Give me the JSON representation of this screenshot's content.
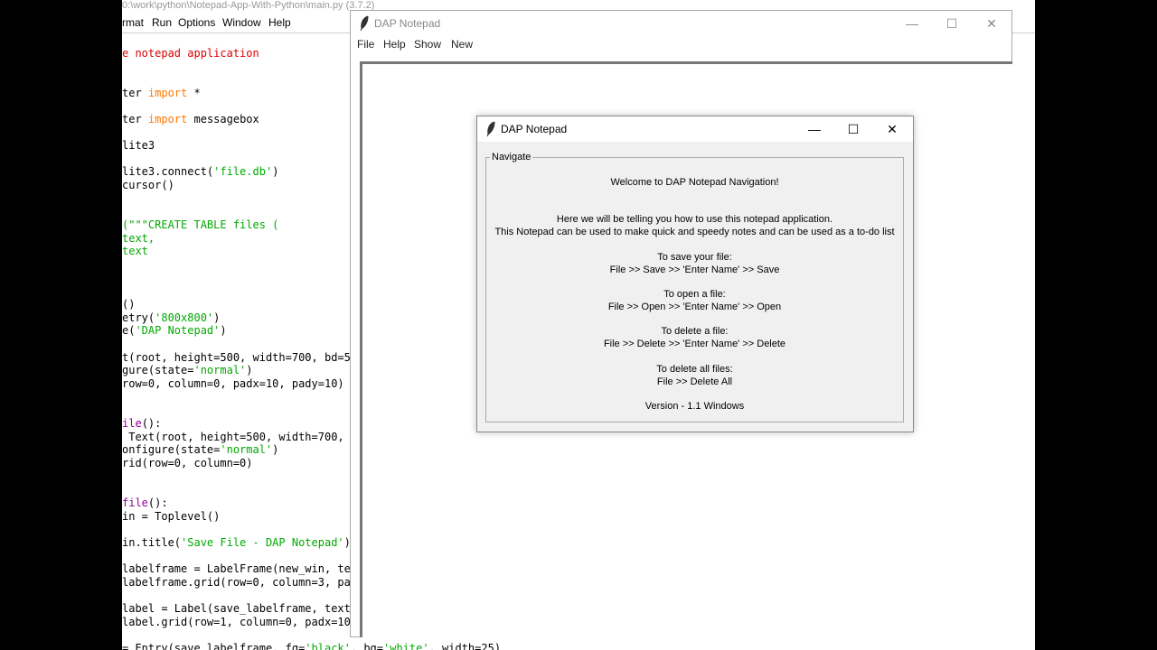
{
  "editor": {
    "title": "0:\\work\\python\\Notepad-App-With-Python\\main.py (3.7.2)",
    "menu": [
      "rmat",
      "Run",
      "Options",
      "Window",
      "Help"
    ],
    "code": [
      [
        {
          "t": "e notepad application",
          "c": "red"
        }
      ],
      [
        {
          "t": "ter ",
          "c": ""
        },
        {
          "t": "import",
          "c": "orange"
        },
        {
          "t": " *",
          "c": ""
        }
      ],
      [
        {
          "t": "ter ",
          "c": ""
        },
        {
          "t": "import",
          "c": "orange"
        },
        {
          "t": " messagebox",
          "c": ""
        }
      ],
      [
        {
          "t": "lite3",
          "c": ""
        }
      ],
      [
        {
          "t": "lite3.connect(",
          "c": ""
        },
        {
          "t": "'file.db'",
          "c": "green"
        },
        {
          "t": ")",
          "c": ""
        }
      ],
      [
        {
          "t": "cursor()",
          "c": ""
        }
      ],
      [
        {
          "t": "(\"\"\"CREATE TABLE files (",
          "c": "green"
        }
      ],
      [
        {
          "t": "text,",
          "c": "green"
        }
      ],
      [
        {
          "t": "text",
          "c": "green"
        }
      ],
      [
        {
          "t": "()",
          "c": ""
        }
      ],
      [
        {
          "t": "etry(",
          "c": ""
        },
        {
          "t": "'800x800'",
          "c": "green"
        },
        {
          "t": ")",
          "c": ""
        }
      ],
      [
        {
          "t": "e(",
          "c": ""
        },
        {
          "t": "'DAP Notepad'",
          "c": "green"
        },
        {
          "t": ")",
          "c": ""
        }
      ],
      [
        {
          "t": "t(root, height=500, width=700, bd=5",
          "c": ""
        }
      ],
      [
        {
          "t": "gure(state=",
          "c": ""
        },
        {
          "t": "'normal'",
          "c": "green"
        },
        {
          "t": ")",
          "c": ""
        }
      ],
      [
        {
          "t": "row=0, column=0, padx=10, pady=10)",
          "c": ""
        }
      ],
      [
        {
          "t": "ile",
          "c": "purple"
        },
        {
          "t": "():",
          "c": ""
        }
      ],
      [
        {
          "t": " Text(root, height=500, width=700,",
          "c": ""
        }
      ],
      [
        {
          "t": "onfigure(state=",
          "c": ""
        },
        {
          "t": "'normal'",
          "c": "green"
        },
        {
          "t": ")",
          "c": ""
        }
      ],
      [
        {
          "t": "rid(row=0, column=0)",
          "c": ""
        }
      ],
      [
        {
          "t": "file",
          "c": "purple"
        },
        {
          "t": "():",
          "c": ""
        }
      ],
      [
        {
          "t": "in = Toplevel()",
          "c": ""
        }
      ],
      [
        {
          "t": "in.title(",
          "c": ""
        },
        {
          "t": "'Save File - DAP Notepad'",
          "c": "green"
        },
        {
          "t": ")",
          "c": ""
        }
      ],
      [
        {
          "t": "labelframe = LabelFrame(new_win, te",
          "c": ""
        }
      ],
      [
        {
          "t": "labelframe.grid(row=0, column=3, pa",
          "c": ""
        }
      ],
      [
        {
          "t": "label = Label(save_labelframe, text",
          "c": ""
        }
      ],
      [
        {
          "t": "label.grid(row=1, column=0, padx=10",
          "c": ""
        }
      ],
      [
        {
          "t": "= Entry(save_labelframe, fg=",
          "c": ""
        },
        {
          "t": "'black'",
          "c": "green"
        },
        {
          "t": ", bg=",
          "c": ""
        },
        {
          "t": "'white'",
          "c": "green"
        },
        {
          "t": ", width=25)",
          "c": ""
        }
      ]
    ]
  },
  "main_window": {
    "title": "DAP Notepad",
    "menu": [
      "File",
      "Help",
      "Show",
      "New"
    ]
  },
  "nav_window": {
    "title": "DAP Notepad",
    "frame_label": "Navigate",
    "lines": [
      "Welcome to DAP Notepad Navigation!",
      "Here we will be telling you how to use this notepad application.",
      "This Notepad can be used to make quick and speedy notes and can be used as a to-do list",
      "To save your file:",
      "File >> Save >> 'Enter Name' >> Save",
      "To open a file:",
      "File >> Open >> 'Enter Name' >> Open",
      "To delete a file:",
      "File >> Delete >> 'Enter Name' >> Delete",
      "To delete all files:",
      "File >> Delete All",
      "Version - 1.1 Windows"
    ]
  },
  "window_controls": {
    "minimize": "—",
    "maximize": "☐",
    "close": "✕"
  },
  "icons": {
    "app": "feather-icon"
  }
}
